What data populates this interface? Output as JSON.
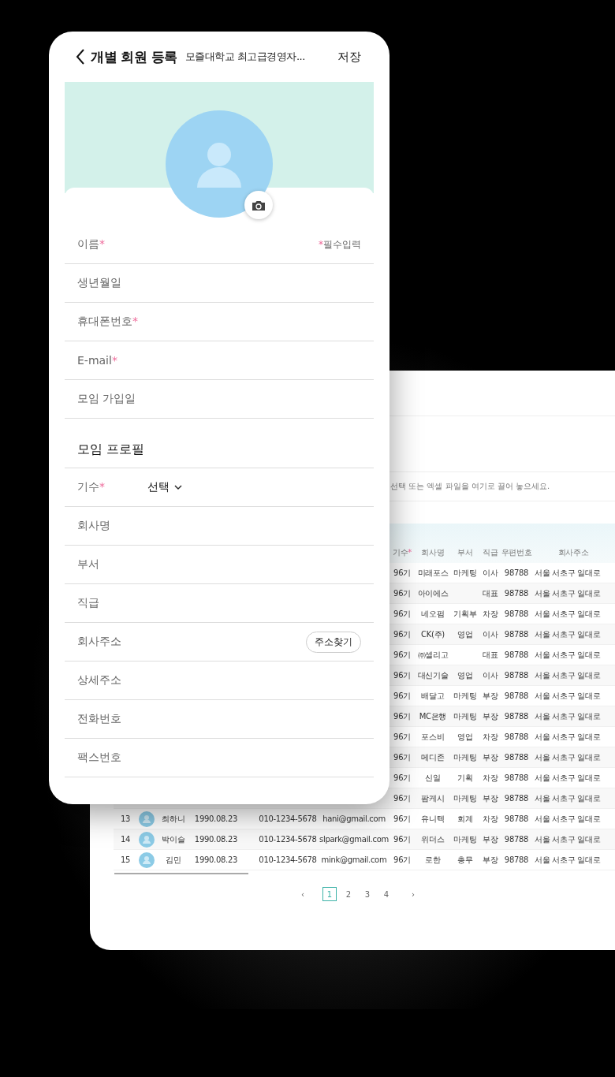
{
  "phone": {
    "title": "개별 회원 등록",
    "subtitle": "모즐대학교 최고급경영자...",
    "save": "저장",
    "required_note": {
      "mark": "*",
      "text": "필수입력"
    },
    "basic_fields": [
      {
        "label": "이름",
        "mark": "*"
      },
      {
        "label": "생년월일"
      },
      {
        "label": "휴대폰번호",
        "mark": "*"
      },
      {
        "label": "E-mail",
        "mark": "*"
      },
      {
        "label": "모임 가입일"
      }
    ],
    "profile_heading": "모임 프로필",
    "profile_fields": [
      {
        "label": "기수",
        "mark": "*",
        "kind": "select",
        "value": "선택"
      },
      {
        "label": "회사명",
        "kind": "text"
      },
      {
        "label": "부서",
        "kind": "text"
      },
      {
        "label": "직급",
        "kind": "text"
      },
      {
        "label": "회사주소",
        "kind": "button",
        "button": "주소찾기"
      },
      {
        "label": "상세주소",
        "kind": "text"
      },
      {
        "label": "전화번호",
        "kind": "text"
      },
      {
        "label": "팩스번호",
        "kind": "text"
      }
    ]
  },
  "table_panel": {
    "upload_hint": "선택 또는 엑셀 파일을 여기로 끌어 놓으세요.",
    "columns": [
      {
        "label": "기수",
        "mark": "*"
      },
      {
        "label": "회사명"
      },
      {
        "label": "부서"
      },
      {
        "label": "직급"
      },
      {
        "label": "우편번호"
      },
      {
        "label": "회사주소"
      }
    ],
    "rows": [
      {
        "cohort": "96기",
        "company": "미래포스",
        "dept": "마케팅",
        "position": "이사",
        "zip": "98788",
        "address": "서울 서초구 일대로"
      },
      {
        "cohort": "96기",
        "company": "아이에스",
        "position": "대표",
        "zip": "98788",
        "address": "서울 서초구 일대로"
      },
      {
        "cohort": "96기",
        "company": "네오펌",
        "dept": "기획부",
        "position": "차장",
        "zip": "98788",
        "address": "서울 서초구 일대로"
      },
      {
        "cohort": "96기",
        "company": "CK(주)",
        "dept": "영업",
        "position": "이사",
        "zip": "98788",
        "address": "서울 서초구 일대로"
      },
      {
        "cohort": "96기",
        "company": "㈜셀리고",
        "position": "대표",
        "zip": "98788",
        "address": "서울 서초구 일대로"
      },
      {
        "cohort": "96기",
        "company": "대신기술",
        "dept": "영업",
        "position": "이사",
        "zip": "98788",
        "address": "서울 서초구 일대로"
      },
      {
        "cohort": "96기",
        "company": "배달고",
        "dept": "마케팅",
        "position": "부장",
        "zip": "98788",
        "address": "서울 서초구 일대로"
      },
      {
        "cohort": "96기",
        "company": "MC은행",
        "dept": "마케팅",
        "position": "부장",
        "zip": "98788",
        "address": "서울 서초구 일대로"
      },
      {
        "cohort": "96기",
        "company": "포스비",
        "dept": "영업",
        "position": "차장",
        "zip": "98788",
        "address": "서울 서초구 일대로"
      },
      {
        "cohort": "96기",
        "company": "메디존",
        "dept": "마케팅",
        "position": "부장",
        "zip": "98788",
        "address": "서울 서초구 일대로"
      },
      {
        "cohort": "96기",
        "company": "신일",
        "dept": "기획",
        "position": "차장",
        "zip": "98788",
        "address": "서울 서초구 일대로"
      },
      {
        "cohort": "96기",
        "company": "팜케시",
        "dept": "마케팅",
        "position": "부장",
        "zip": "98788",
        "address": "서울 서초구 일대로"
      },
      {
        "no": "13",
        "avatar": true,
        "name": "최하니",
        "birth": "1990.08.23",
        "phone": "010-1234-5678",
        "email": "hani@gmail.com",
        "cohort": "96기",
        "company": "유니텍",
        "dept": "회계",
        "position": "차장",
        "zip": "98788",
        "address": "서울 서초구 일대로"
      },
      {
        "no": "14",
        "avatar": true,
        "name": "박이슬",
        "birth": "1990.08.23",
        "phone": "010-1234-5678",
        "email": "slpark@gmail.com",
        "cohort": "96기",
        "company": "위더스",
        "dept": "마케팅",
        "position": "부장",
        "zip": "98788",
        "address": "서울 서초구 일대로"
      },
      {
        "no": "15",
        "avatar": true,
        "name": "김민",
        "birth": "1990.08.23",
        "phone": "010-1234-5678",
        "email": "mink@gmail.com",
        "cohort": "96기",
        "company": "로한",
        "dept": "총무",
        "position": "부장",
        "zip": "98788",
        "address": "서울 서초구 일대로"
      }
    ],
    "pagination": {
      "prev": "‹",
      "next": "›",
      "pages": [
        {
          "label": "1",
          "selected": true
        },
        {
          "label": "2",
          "selected": false
        },
        {
          "label": "3",
          "selected": false
        },
        {
          "label": "4",
          "selected": false
        }
      ]
    }
  }
}
